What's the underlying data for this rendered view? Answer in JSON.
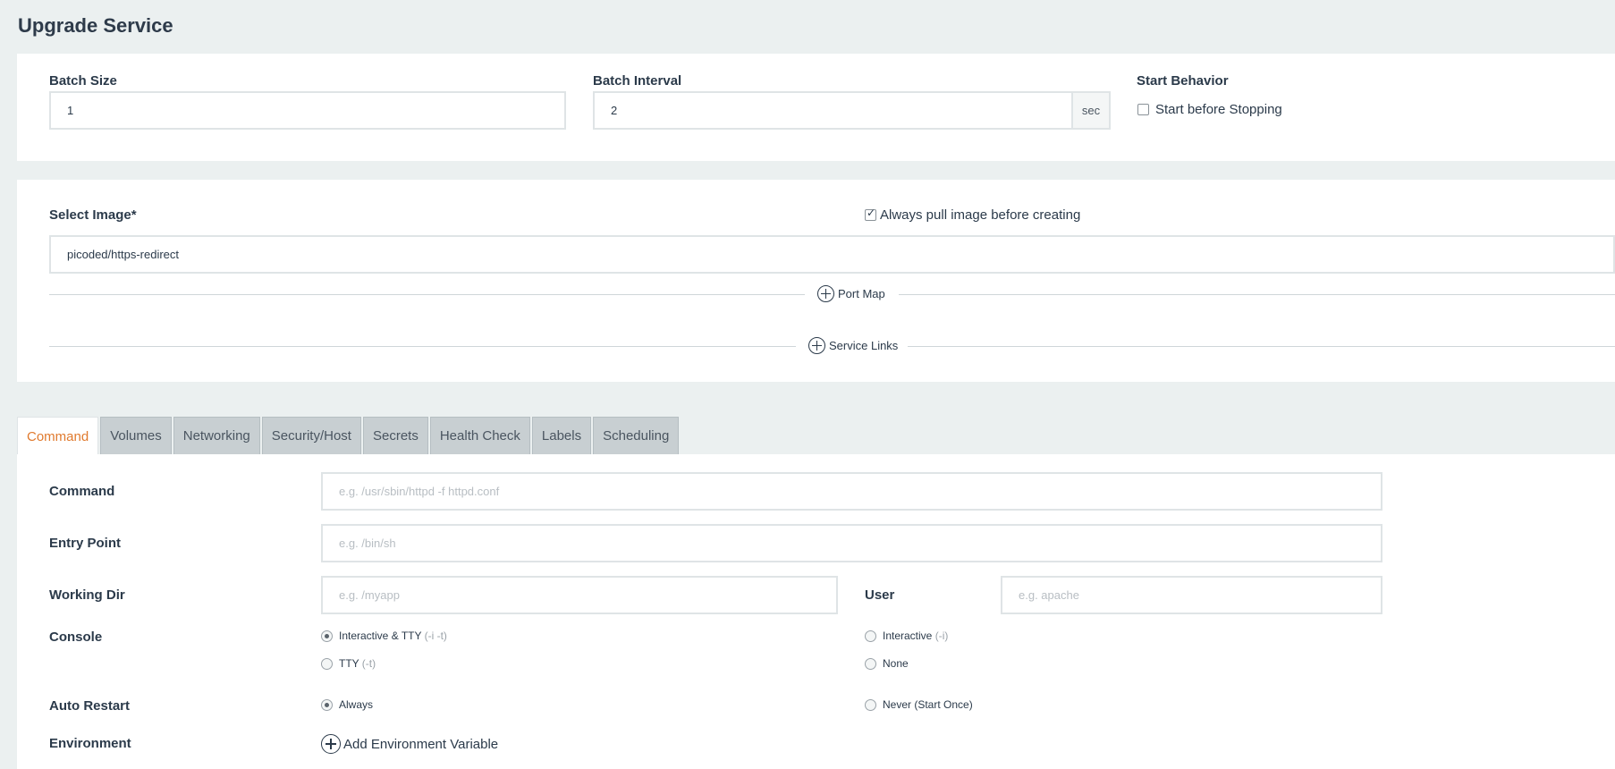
{
  "page": {
    "title": "Upgrade Service"
  },
  "upgrade": {
    "batch_size_label": "Batch Size",
    "batch_size_value": "1",
    "batch_interval_label": "Batch Interval",
    "batch_interval_value": "2",
    "batch_interval_unit": "sec",
    "start_behavior_label": "Start Behavior",
    "start_before_stopping_label": "Start before Stopping",
    "start_before_stopping_checked": false
  },
  "image": {
    "select_image_label": "Select Image*",
    "image_value": "picoded/https-redirect",
    "always_pull_label": "Always pull image before creating",
    "always_pull_checked": true,
    "port_map_label": "Port Map",
    "service_links_label": "Service Links"
  },
  "tabs": [
    {
      "label": "Command",
      "active": true
    },
    {
      "label": "Volumes"
    },
    {
      "label": "Networking"
    },
    {
      "label": "Security/Host"
    },
    {
      "label": "Secrets"
    },
    {
      "label": "Health Check"
    },
    {
      "label": "Labels"
    },
    {
      "label": "Scheduling"
    }
  ],
  "command": {
    "command_label": "Command",
    "command_placeholder": "e.g. /usr/sbin/httpd -f httpd.conf",
    "entry_point_label": "Entry Point",
    "entry_point_placeholder": "e.g. /bin/sh",
    "working_dir_label": "Working Dir",
    "working_dir_placeholder": "e.g. /myapp",
    "user_label": "User",
    "user_placeholder": "e.g. apache",
    "console_label": "Console",
    "console_options": [
      {
        "label": "Interactive & TTY",
        "hint": "(-i -t)",
        "selected": true
      },
      {
        "label": "Interactive",
        "hint": "(-i)",
        "selected": false
      },
      {
        "label": "TTY",
        "hint": "(-t)",
        "selected": false
      },
      {
        "label": "None",
        "hint": "",
        "selected": false
      }
    ],
    "auto_restart_label": "Auto Restart",
    "auto_restart_options": [
      {
        "label": "Always",
        "selected": true
      },
      {
        "label": "Never (Start Once)",
        "selected": false
      }
    ],
    "environment_label": "Environment",
    "add_env_label": "Add Environment Variable"
  }
}
